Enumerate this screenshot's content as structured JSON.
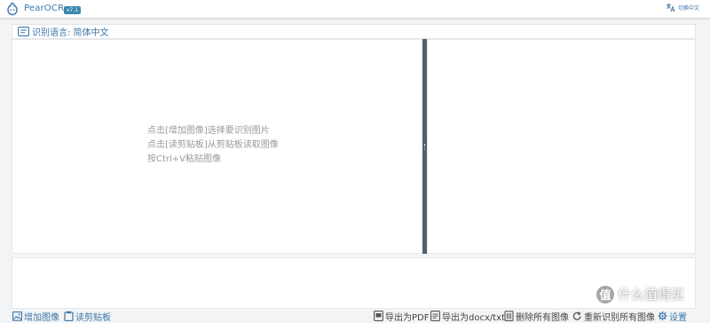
{
  "header": {
    "app_title": "PearOCR",
    "version": "v7.1",
    "lang_toggle_label": "切换中文"
  },
  "language_bar": {
    "label": "识别语言: 简体中文"
  },
  "main": {
    "hints": [
      "点击[增加图像]选择要识别图片",
      "点击[读剪贴板]从剪贴板读取图像",
      "按Ctrl+V粘贴图像"
    ]
  },
  "toolbar": {
    "add_image": "增加图像",
    "read_clipboard": "读剪贴板",
    "export_pdf": "导出为PDF",
    "export_docx": "导出为docx/txt",
    "delete_all": "删除所有图像",
    "reidentify_all": "重新识别所有图像",
    "settings": "设置"
  },
  "watermark": {
    "text": "什么值得买",
    "badge": "值"
  },
  "colors": {
    "accent": "#3e76a7",
    "badge": "#3a87ad",
    "divider": "#50606d",
    "hint_text": "#9a9a9a"
  },
  "icons": [
    "pear-logo-icon",
    "translate-icon",
    "language-icon",
    "image-add-icon",
    "clipboard-icon",
    "pdf-icon",
    "docx-icon",
    "trash-icon",
    "refresh-icon",
    "gear-icon"
  ]
}
